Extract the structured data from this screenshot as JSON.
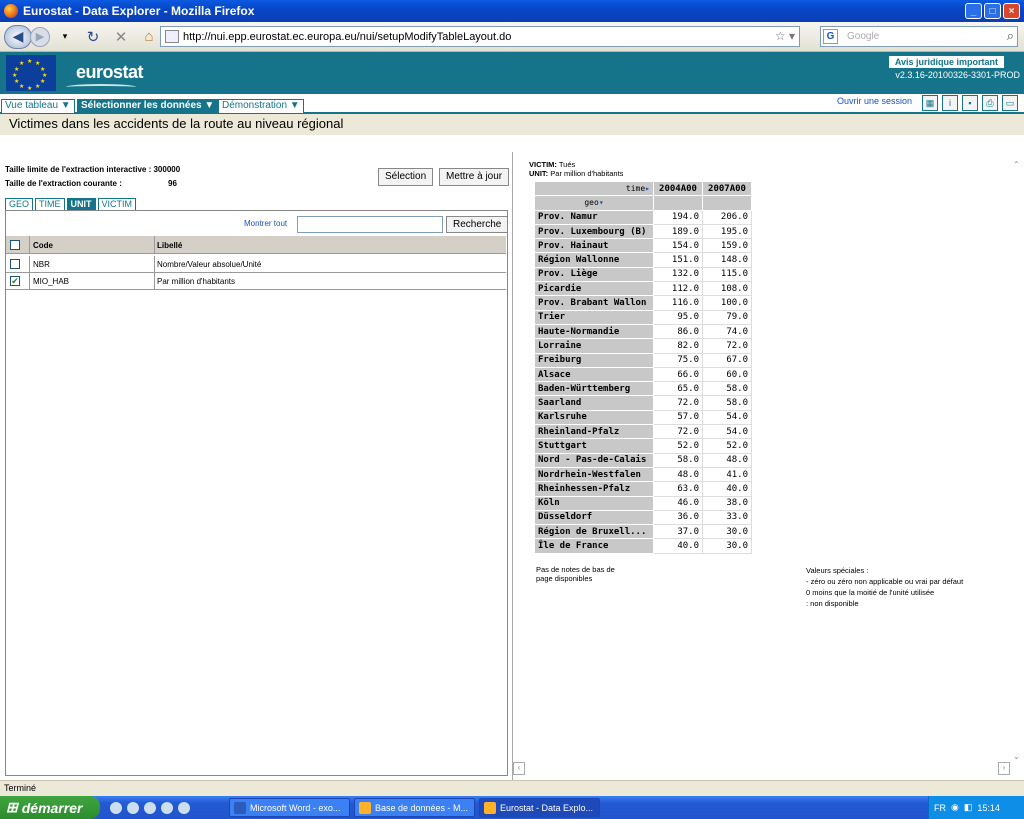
{
  "window": {
    "title": "Eurostat - Data Explorer - Mozilla Firefox"
  },
  "browser": {
    "url": "http://nui.epp.eurostat.ec.europa.eu/nui/setupModifyTableLayout.do",
    "search_placeholder": "Google",
    "status": "Terminé"
  },
  "header": {
    "logo_text": "eurostat",
    "legal_link": "Avis juridique important",
    "version": "v2.3.16-20100326-3301-PROD"
  },
  "menu": {
    "items": [
      "Vue tableau ▼",
      "Sélectionner les données ▼",
      "Démonstration ▼"
    ],
    "session_link": "Ouvrir une session"
  },
  "page": {
    "title": "Victimes dans les accidents de la route au niveau régional",
    "limit_label": "Taille limite de l'extraction interactive :",
    "limit_value": "300000",
    "current_label": "Taille de l'extraction courante :",
    "current_value": "96",
    "selection_button": "Sélection",
    "update_button": "Mettre à jour"
  },
  "dimension_tabs": [
    "GEO",
    "TIME",
    "UNIT",
    "VICTIM"
  ],
  "filter": {
    "show_all": "Montrer tout",
    "search_button": "Recherche"
  },
  "unit_grid": {
    "headers": [
      "Code",
      "Libellé"
    ],
    "rows": [
      {
        "code": "NBR",
        "label": "Nombre/Valeur absolue/Unité",
        "checked": false
      },
      {
        "code": "MIO_HAB",
        "label": "Par million d'habitants",
        "checked": true
      }
    ]
  },
  "table_meta": {
    "victim_label": "VICTIM:",
    "victim_value": "Tués",
    "unit_label": "UNIT:",
    "unit_value": "Par million d'habitants"
  },
  "data_table": {
    "time_label": "time",
    "geo_label": "geo",
    "columns": [
      "2004A00",
      "2007A00"
    ],
    "rows": [
      {
        "geo": "Prov. Namur",
        "v": [
          "194.0",
          "206.0"
        ]
      },
      {
        "geo": "Prov. Luxembourg (B)",
        "v": [
          "189.0",
          "195.0"
        ]
      },
      {
        "geo": "Prov. Hainaut",
        "v": [
          "154.0",
          "159.0"
        ]
      },
      {
        "geo": "Région Wallonne",
        "v": [
          "151.0",
          "148.0"
        ]
      },
      {
        "geo": "Prov. Liège",
        "v": [
          "132.0",
          "115.0"
        ]
      },
      {
        "geo": "Picardie",
        "v": [
          "112.0",
          "108.0"
        ]
      },
      {
        "geo": "Prov. Brabant Wallon",
        "v": [
          "116.0",
          "100.0"
        ]
      },
      {
        "geo": "Trier",
        "v": [
          "95.0",
          "79.0"
        ]
      },
      {
        "geo": "Haute-Normandie",
        "v": [
          "86.0",
          "74.0"
        ]
      },
      {
        "geo": "Lorraine",
        "v": [
          "82.0",
          "72.0"
        ]
      },
      {
        "geo": "Freiburg",
        "v": [
          "75.0",
          "67.0"
        ]
      },
      {
        "geo": "Alsace",
        "v": [
          "66.0",
          "60.0"
        ]
      },
      {
        "geo": "Baden-Württemberg",
        "v": [
          "65.0",
          "58.0"
        ]
      },
      {
        "geo": "Saarland",
        "v": [
          "72.0",
          "58.0"
        ]
      },
      {
        "geo": "Karlsruhe",
        "v": [
          "57.0",
          "54.0"
        ]
      },
      {
        "geo": "Rheinland-Pfalz",
        "v": [
          "72.0",
          "54.0"
        ]
      },
      {
        "geo": "Stuttgart",
        "v": [
          "52.0",
          "52.0"
        ]
      },
      {
        "geo": "Nord - Pas-de-Calais",
        "v": [
          "58.0",
          "48.0"
        ]
      },
      {
        "geo": "Nordrhein-Westfalen",
        "v": [
          "48.0",
          "41.0"
        ]
      },
      {
        "geo": "Rheinhessen-Pfalz",
        "v": [
          "63.0",
          "40.0"
        ]
      },
      {
        "geo": "Köln",
        "v": [
          "46.0",
          "38.0"
        ]
      },
      {
        "geo": "Düsseldorf",
        "v": [
          "36.0",
          "33.0"
        ]
      },
      {
        "geo": "Région de Bruxell...",
        "v": [
          "37.0",
          "30.0"
        ]
      },
      {
        "geo": "Île de France",
        "v": [
          "40.0",
          "30.0"
        ]
      }
    ]
  },
  "footnotes": "Pas de notes de bas de page disponibles",
  "special_values": {
    "title": "Valeurs spéciales :",
    "lines": [
      "-  zéro ou zéro non applicable ou vrai par défaut",
      "0  moins que la moitié de l'unité utilisée",
      ":  non disponible"
    ]
  },
  "taskbar": {
    "start": "démarrer",
    "tasks": [
      "Microsoft Word - exo...",
      "Base de données - M...",
      "Eurostat - Data Explo..."
    ],
    "lang": "FR",
    "clock": "15:14"
  },
  "colors": {
    "eurostat_teal": "#15748a",
    "xp_blue": "#2459d4"
  }
}
